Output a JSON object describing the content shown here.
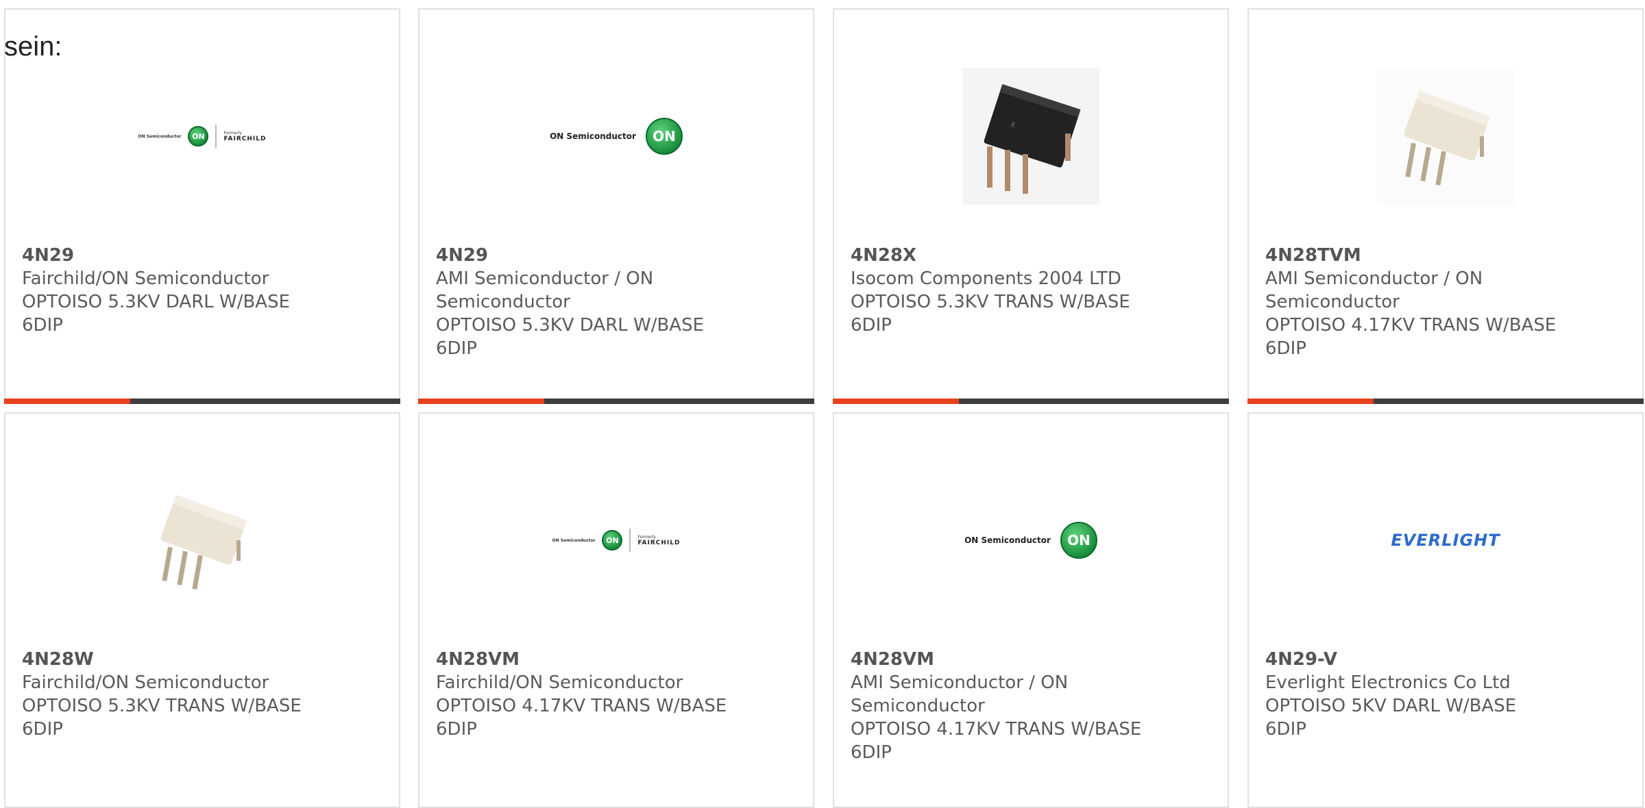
{
  "intro": "sein:",
  "cards": [
    {
      "part": "4N29",
      "manufacturer": "Fairchild/ON Semiconductor",
      "description": "OPTOISO 5.3KV DARL W/BASE",
      "package": "6DIP",
      "logo": {
        "on": "ON Semiconductor",
        "formerly": "Formerly",
        "fairchild": "FAIRCHILD"
      }
    },
    {
      "part": "4N29",
      "manufacturer": "AMI Semiconductor / ON Semiconductor",
      "description": "OPTOISO 5.3KV DARL W/BASE",
      "package": "6DIP",
      "logo": {
        "on": "ON Semiconductor"
      }
    },
    {
      "part": "4N28X",
      "manufacturer": "Isocom Components 2004 LTD",
      "description": "OPTOISO 5.3KV TRANS W/BASE",
      "package": "6DIP",
      "image": "black-6dip-chip"
    },
    {
      "part": "4N28TVM",
      "manufacturer": "AMI Semiconductor / ON Semiconductor",
      "description": "OPTOISO 4.17KV TRANS W/BASE",
      "package": "6DIP",
      "image": "white-6dip-chip"
    },
    {
      "part": "4N28W",
      "manufacturer": "Fairchild/ON Semiconductor",
      "description": "OPTOISO 5.3KV TRANS W/BASE",
      "package": "6DIP",
      "image": "white-6dip-chip"
    },
    {
      "part": "4N28VM",
      "manufacturer": "Fairchild/ON Semiconductor",
      "description": "OPTOISO 4.17KV TRANS W/BASE",
      "package": "6DIP",
      "logo": {
        "on": "ON Semiconductor",
        "formerly": "Formerly",
        "fairchild": "FAIRCHILD"
      }
    },
    {
      "part": "4N28VM",
      "manufacturer": "AMI Semiconductor / ON Semiconductor",
      "description": "OPTOISO 4.17KV TRANS W/BASE",
      "package": "6DIP",
      "logo": {
        "on": "ON Semiconductor"
      }
    },
    {
      "part": "4N29-V",
      "manufacturer": "Everlight Electronics Co Ltd",
      "description": "OPTOISO 5KV DARL W/BASE",
      "package": "6DIP",
      "logo": {
        "everlight": "EVERLIGHT"
      }
    }
  ],
  "colors": {
    "accent": "#e8401c",
    "bar": "#3d3d3d",
    "border": "#e0e0e0"
  }
}
